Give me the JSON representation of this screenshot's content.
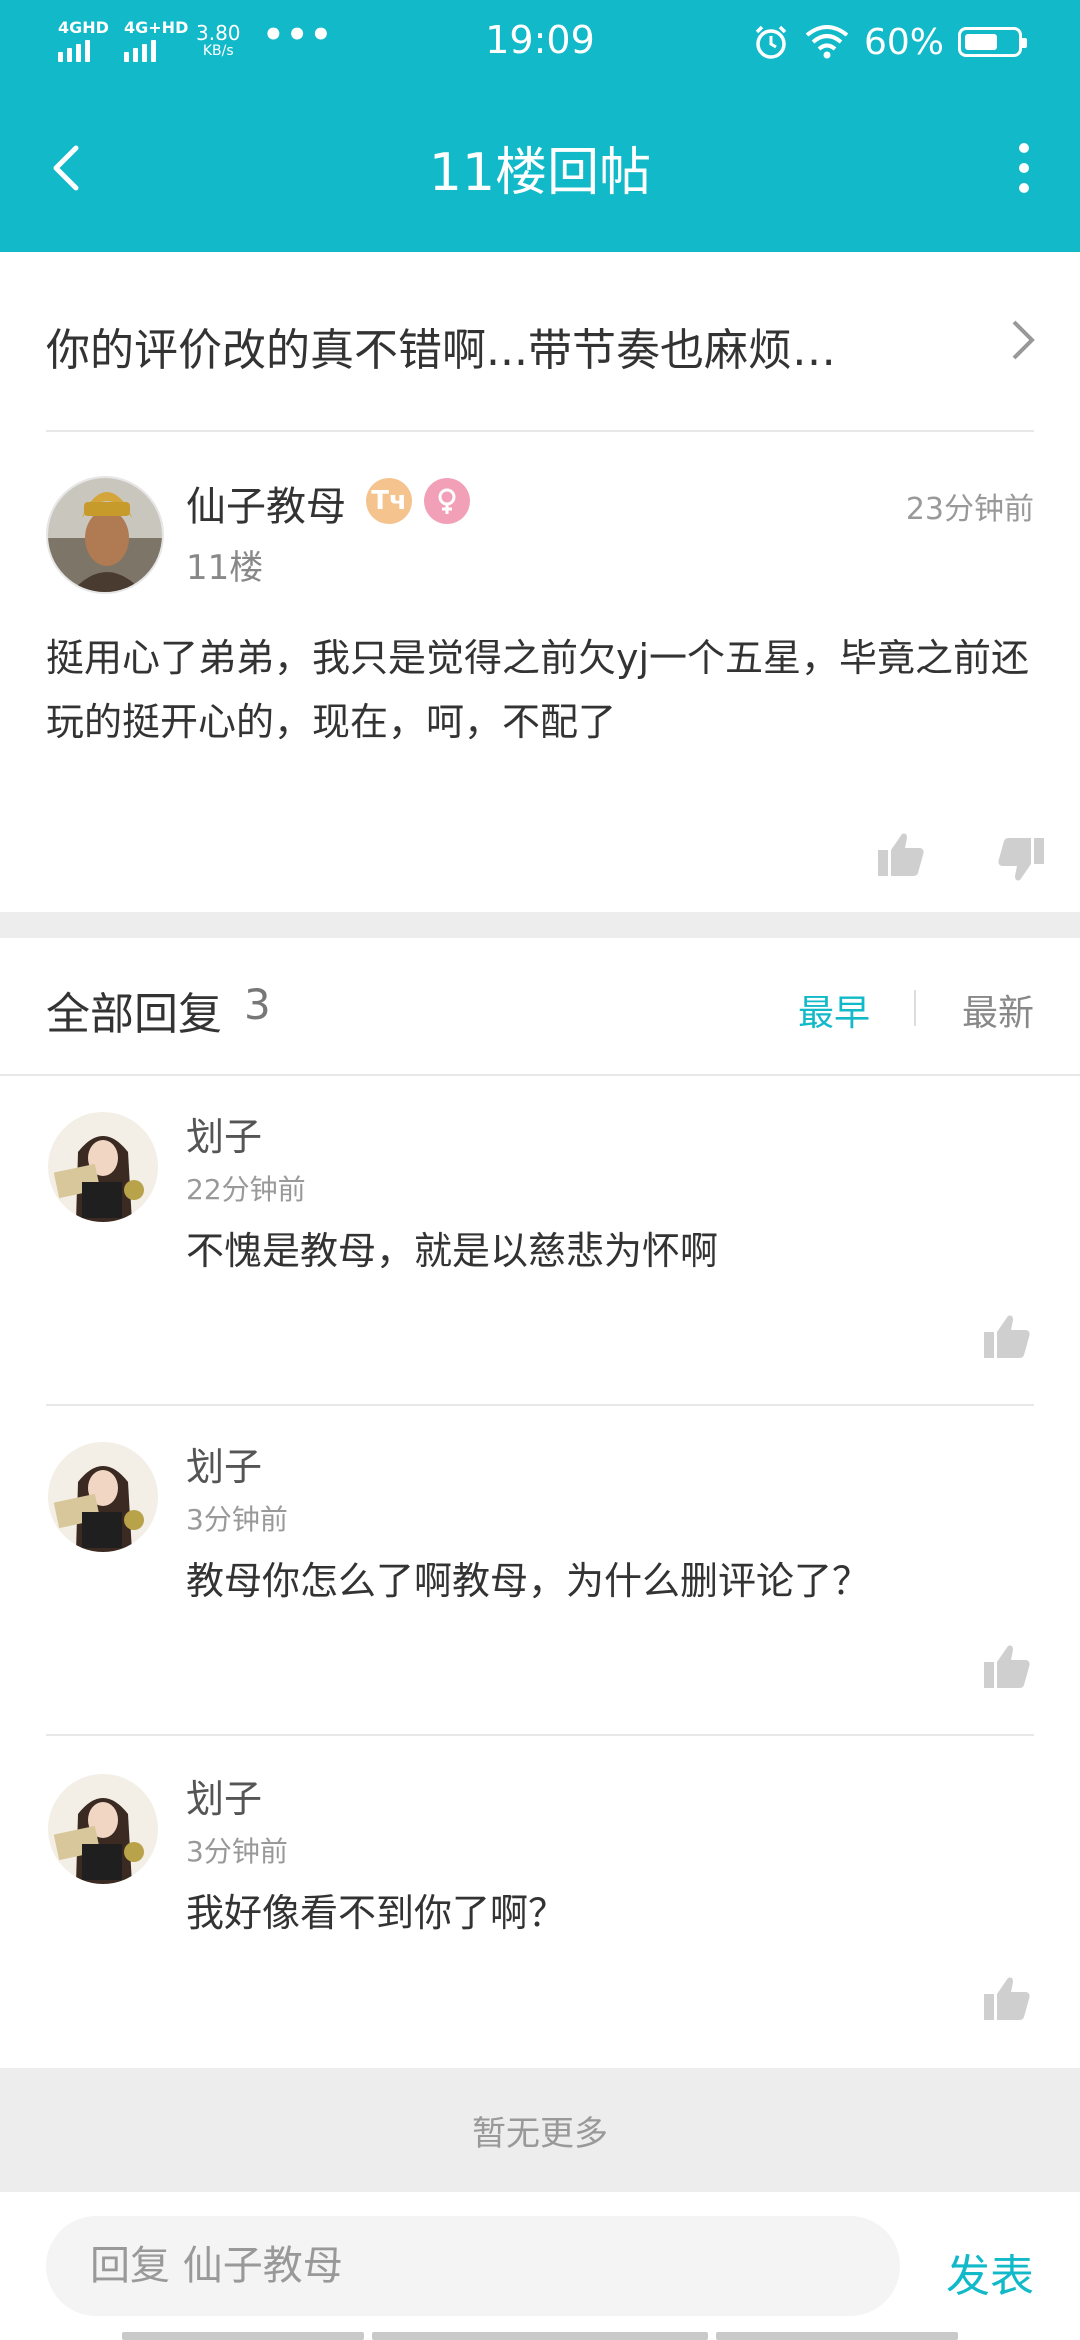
{
  "status_bar": {
    "signal1": "4GHD",
    "signal2": "4G+HD",
    "speed_value": "3.80",
    "speed_unit": "KB/s",
    "more_dots": "•••",
    "time": "19:09",
    "battery": "60%"
  },
  "nav": {
    "title": "11楼回帖"
  },
  "topic": {
    "text": "你的评价改的真不错啊...带节奏也麻烦…"
  },
  "post": {
    "author": "仙子教母",
    "badge_text": "Tч",
    "floor": "11楼",
    "time": "23分钟前",
    "body": "挺用心了弟弟，我只是觉得之前欠yj一个五星，毕竟之前还玩的挺开心的，现在，呵，不配了"
  },
  "replies_header": {
    "title": "全部回复",
    "count": "3",
    "sort_earliest": "最早",
    "sort_latest": "最新"
  },
  "replies": [
    {
      "name": "划子",
      "time": "22分钟前",
      "text": "不愧是教母，就是以慈悲为怀啊"
    },
    {
      "name": "划子",
      "time": "3分钟前",
      "text": "教母你怎么了啊教母，为什么删评论了？"
    },
    {
      "name": "划子",
      "time": "3分钟前",
      "text": "我好像看不到你了啊？"
    }
  ],
  "footer": {
    "no_more": "暂无更多"
  },
  "input": {
    "placeholder": "回复 仙子教母",
    "send_label": "发表"
  },
  "colors": {
    "accent": "#12b9c9",
    "band": "#ededed"
  }
}
